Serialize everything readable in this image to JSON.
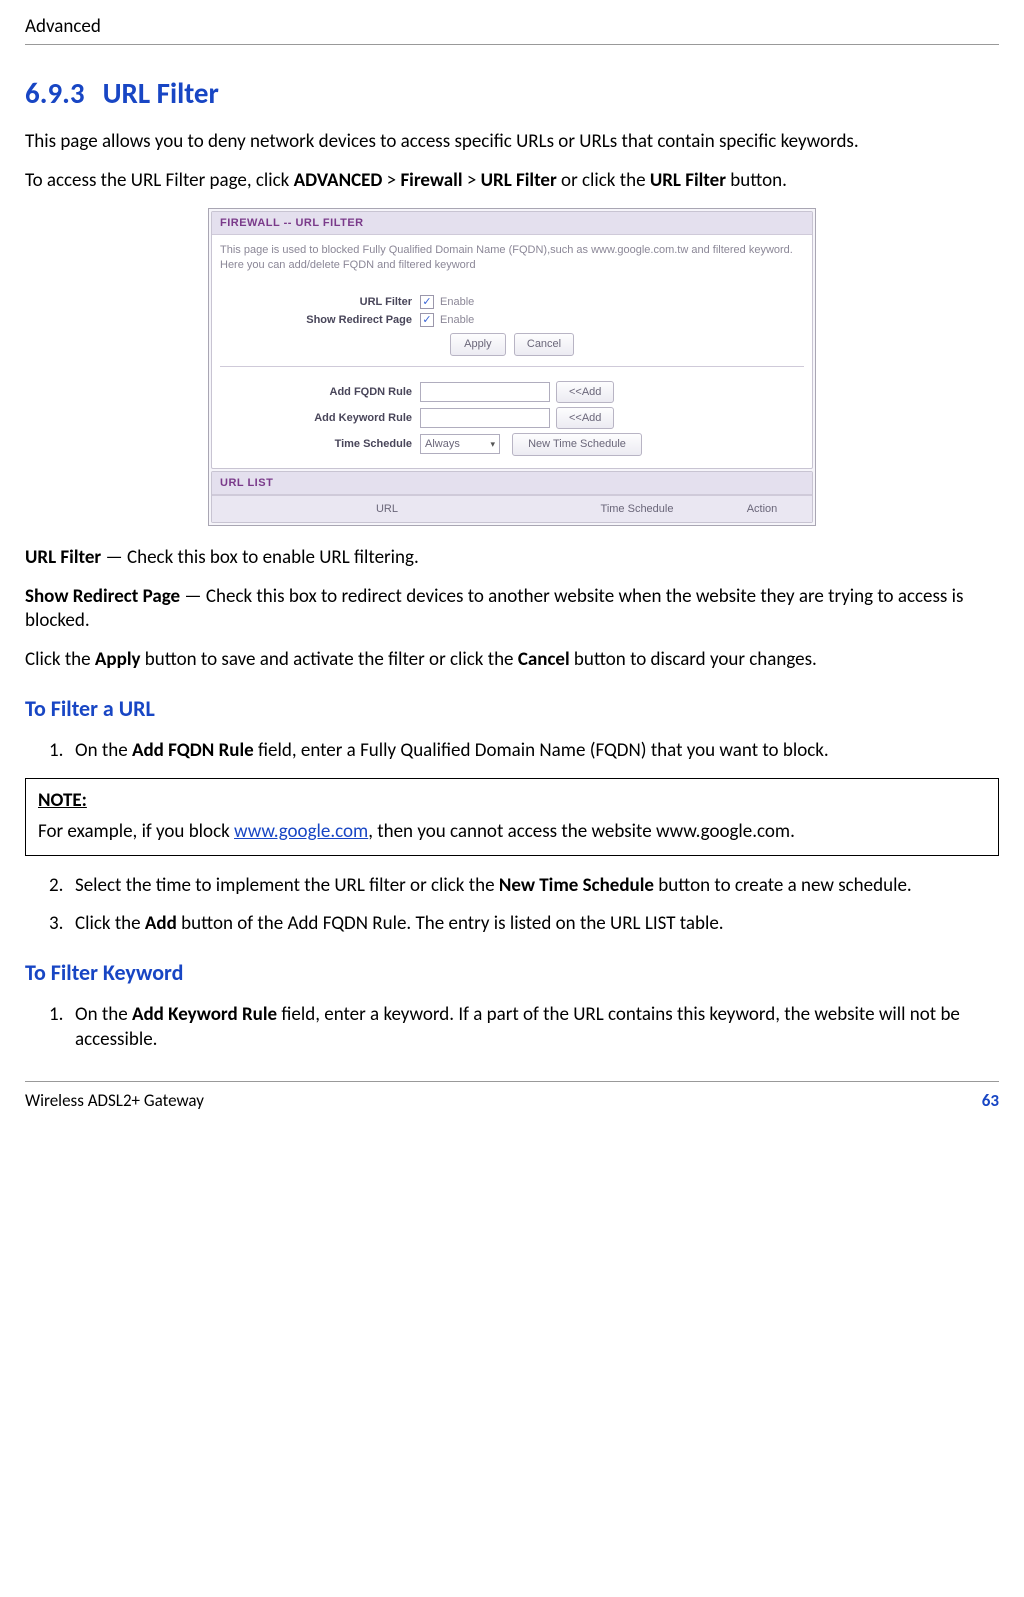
{
  "header": {
    "title": "Advanced"
  },
  "section": {
    "number": "6.9.3",
    "title": "URL Filter",
    "intro": "This page allows you to deny network devices to access specific URLs or URLs that contain specific keywords.",
    "access_pre": "To access the URL Filter page, click ",
    "access_path1": "ADVANCED",
    "access_sep1": " > ",
    "access_path2": "Firewall",
    "access_sep2": " > ",
    "access_path3": "URL Filter",
    "access_mid": " or click the ",
    "access_path4": "URL Filter",
    "access_post": " button."
  },
  "screenshot": {
    "panel_title": "FIREWALL -- URL FILTER",
    "desc": "This page is used to blocked Fully Qualified Domain Name (FQDN),such as www.google.com.tw and filtered keyword. Here you can add/delete FQDN and filtered keyword",
    "labels": {
      "url_filter": "URL Filter",
      "show_redirect": "Show Redirect Page",
      "enable": "Enable",
      "apply": "Apply",
      "cancel": "Cancel",
      "add_fqdn": "Add FQDN Rule",
      "add_keyword": "Add Keyword Rule",
      "time_schedule": "Time Schedule",
      "add_btn": "<<Add",
      "new_time": "New Time Schedule",
      "always": "Always",
      "url_list": "URL LIST",
      "col_url": "URL",
      "col_sched": "Time Schedule",
      "col_action": "Action"
    }
  },
  "defs": {
    "url_filter_label": "URL Filter",
    "url_filter_text": " — Check this box to enable URL filtering.",
    "show_redirect_label": "Show Redirect Page",
    "show_redirect_text": " — Check this box to redirect devices to another website when the website they are trying to access is blocked.",
    "apply_pre": "Click the ",
    "apply_b": "Apply",
    "apply_mid": " button to save and activate the filter or click the ",
    "cancel_b": "Cancel",
    "apply_post": " button to discard your changes."
  },
  "filter_url": {
    "heading": "To Filter a URL",
    "step1_pre": "On the ",
    "step1_b": "Add FQDN Rule",
    "step1_post": " field, enter a Fully Qualified Domain Name (FQDN) that you want to block.",
    "note_label": "NOTE:",
    "note_pre": "For example, if you block ",
    "note_link": "www.google.com",
    "note_post": ", then you cannot access the website www.google.com.",
    "step2_pre": "Select the time to implement the URL filter or click the ",
    "step2_b": "New Time Schedule",
    "step2_post": " button to create a new schedule.",
    "step3_pre": "Click the ",
    "step3_b": "Add",
    "step3_post": " button of the Add FQDN Rule. The entry is listed on the URL LIST table."
  },
  "filter_keyword": {
    "heading": "To Filter Keyword",
    "step1_pre": "On the ",
    "step1_b": "Add Keyword Rule",
    "step1_post": " field, enter a keyword. If a part of the URL contains this keyword, the website will not be accessible."
  },
  "footer": {
    "product": "Wireless ADSL2+ Gateway",
    "page": "63"
  },
  "nums": {
    "n1": "1.",
    "n2": "2.",
    "n3": "3."
  }
}
